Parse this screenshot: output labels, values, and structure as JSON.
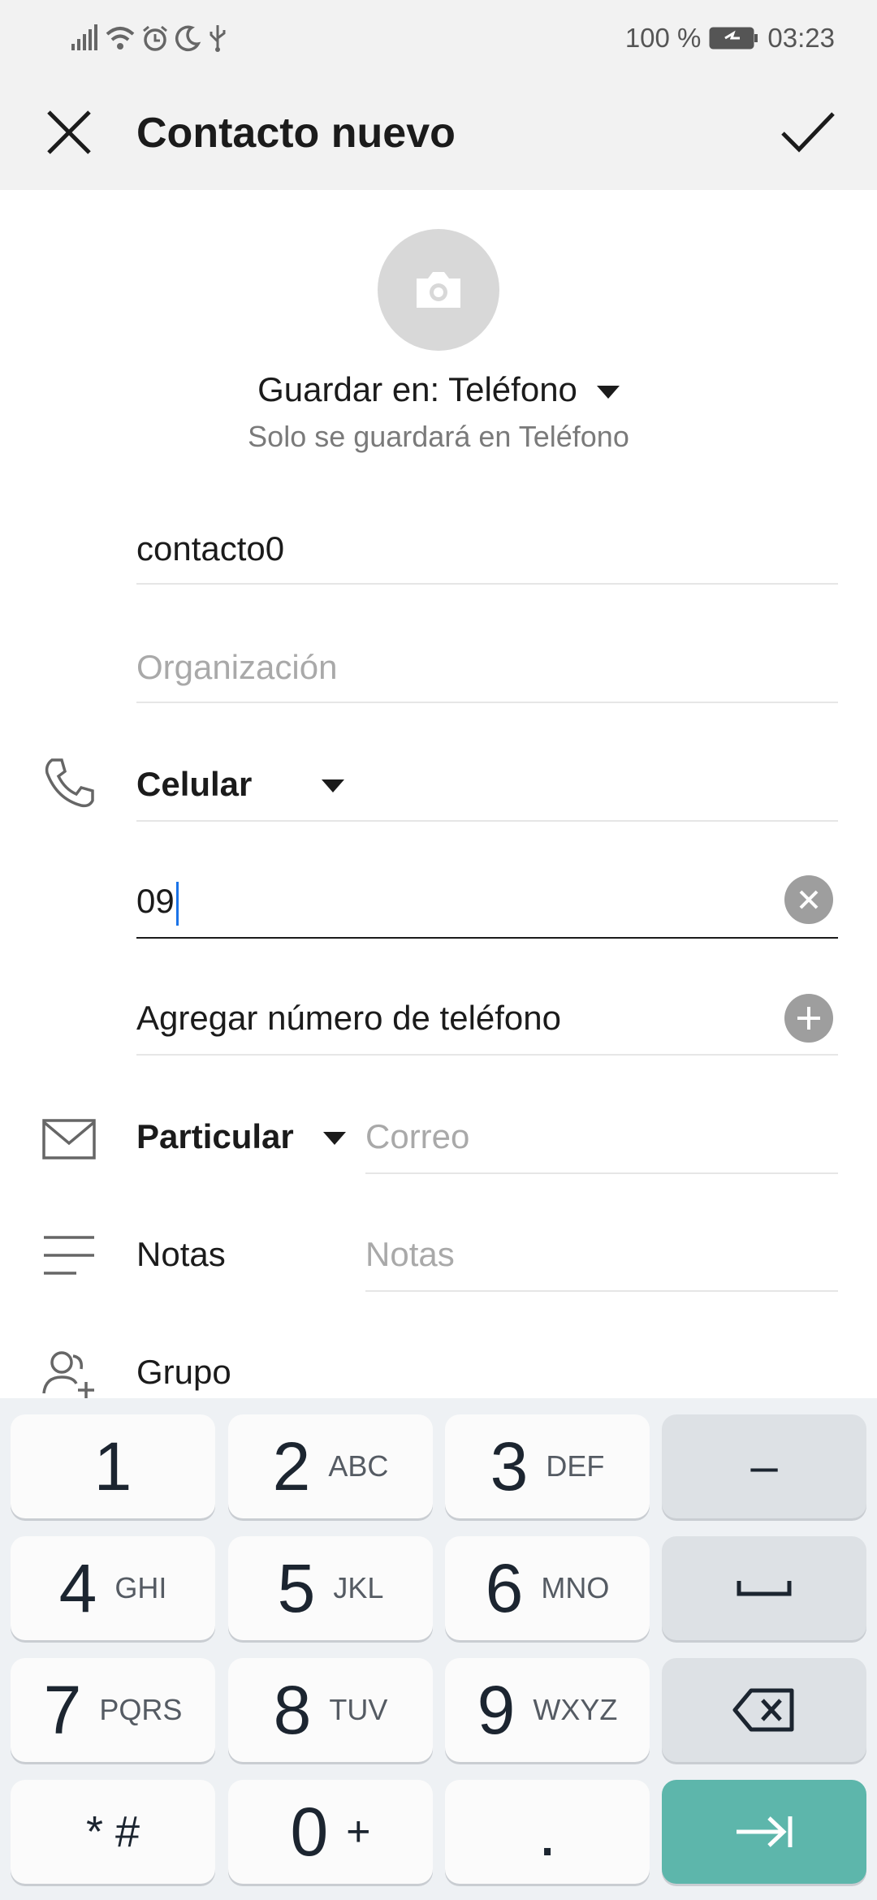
{
  "status_bar": {
    "battery_text": "100 %",
    "time": "03:23"
  },
  "app_bar": {
    "title": "Contacto nuevo"
  },
  "account": {
    "save_label": "Guardar en: Teléfono",
    "save_note": "Solo se guardará en Teléfono"
  },
  "fields": {
    "name_value": "contacto0",
    "organization_placeholder": "Organización",
    "phone_type": "Celular",
    "phone_value": "09",
    "add_phone_label": "Agregar número de teléfono",
    "email_type": "Particular",
    "email_placeholder": "Correo",
    "notes_label": "Notas",
    "notes_placeholder": "Notas",
    "group_label": "Grupo"
  },
  "keyboard": {
    "keys": [
      {
        "num": "1",
        "letters": ""
      },
      {
        "num": "2",
        "letters": "ABC"
      },
      {
        "num": "3",
        "letters": "DEF"
      },
      {
        "num": "4",
        "letters": "GHI"
      },
      {
        "num": "5",
        "letters": "JKL"
      },
      {
        "num": "6",
        "letters": "MNO"
      },
      {
        "num": "7",
        "letters": "PQRS"
      },
      {
        "num": "8",
        "letters": "TUV"
      },
      {
        "num": "9",
        "letters": "WXYZ"
      },
      {
        "num": "* #",
        "letters": ""
      },
      {
        "num": "0",
        "letters": "+"
      },
      {
        "num": ".",
        "letters": ""
      }
    ],
    "minus_key": "–",
    "accent_color": "#5db6ab"
  }
}
